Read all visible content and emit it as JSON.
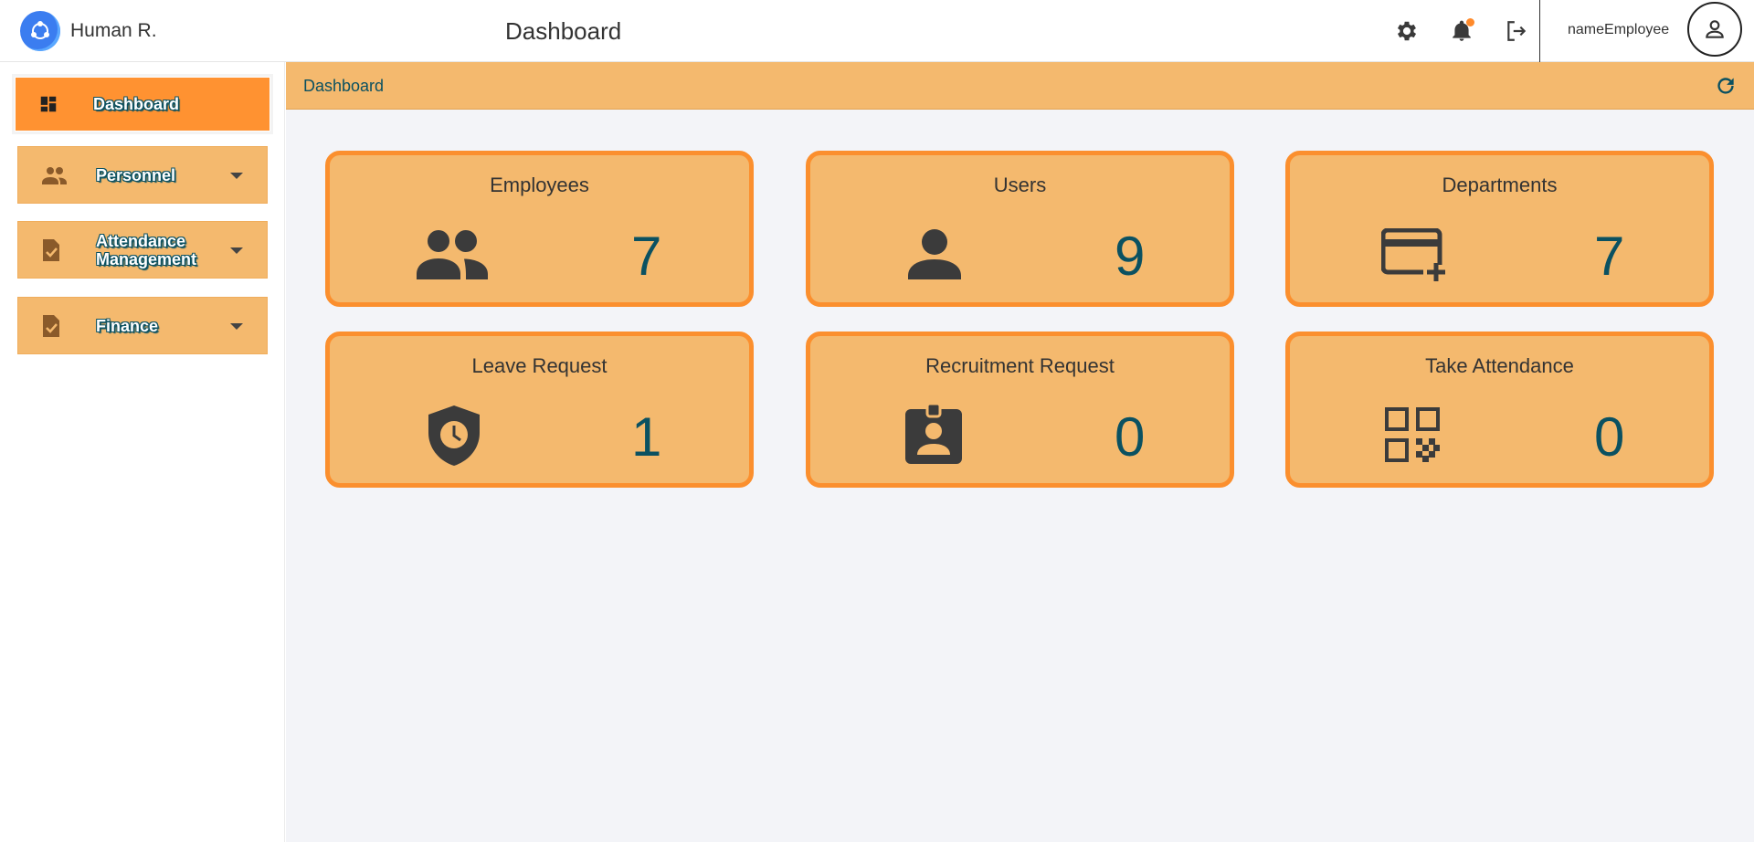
{
  "app": {
    "name": "Human R."
  },
  "header": {
    "title": "Dashboard",
    "user_name": "nameEmployee"
  },
  "sidebar": {
    "items": [
      {
        "label": "Dashboard",
        "icon": "dashboard-icon",
        "active": true,
        "expandable": false
      },
      {
        "label": "Personnel",
        "icon": "people-icon",
        "active": false,
        "expandable": true
      },
      {
        "label": "Attendance Management",
        "icon": "assignment-check-icon",
        "active": false,
        "expandable": true
      },
      {
        "label": "Finance",
        "icon": "assignment-check-icon",
        "active": false,
        "expandable": true
      }
    ]
  },
  "breadcrumb": "Dashboard",
  "cards": [
    {
      "title": "Employees",
      "value": "7",
      "icon": "people-icon"
    },
    {
      "title": "Users",
      "value": "9",
      "icon": "person-icon"
    },
    {
      "title": "Departments",
      "value": "7",
      "icon": "add-card-icon"
    },
    {
      "title": "Leave Request",
      "value": "1",
      "icon": "shield-clock-icon"
    },
    {
      "title": "Recruitment Request",
      "value": "0",
      "icon": "badge-icon"
    },
    {
      "title": "Take Attendance",
      "value": "0",
      "icon": "qr-code-icon"
    }
  ],
  "colors": {
    "accent": "#ff9231",
    "card_bg": "#f4b96e",
    "card_border": "#fb8f2e",
    "value_text": "#0b5161",
    "main_bg": "#f3f4f8"
  }
}
